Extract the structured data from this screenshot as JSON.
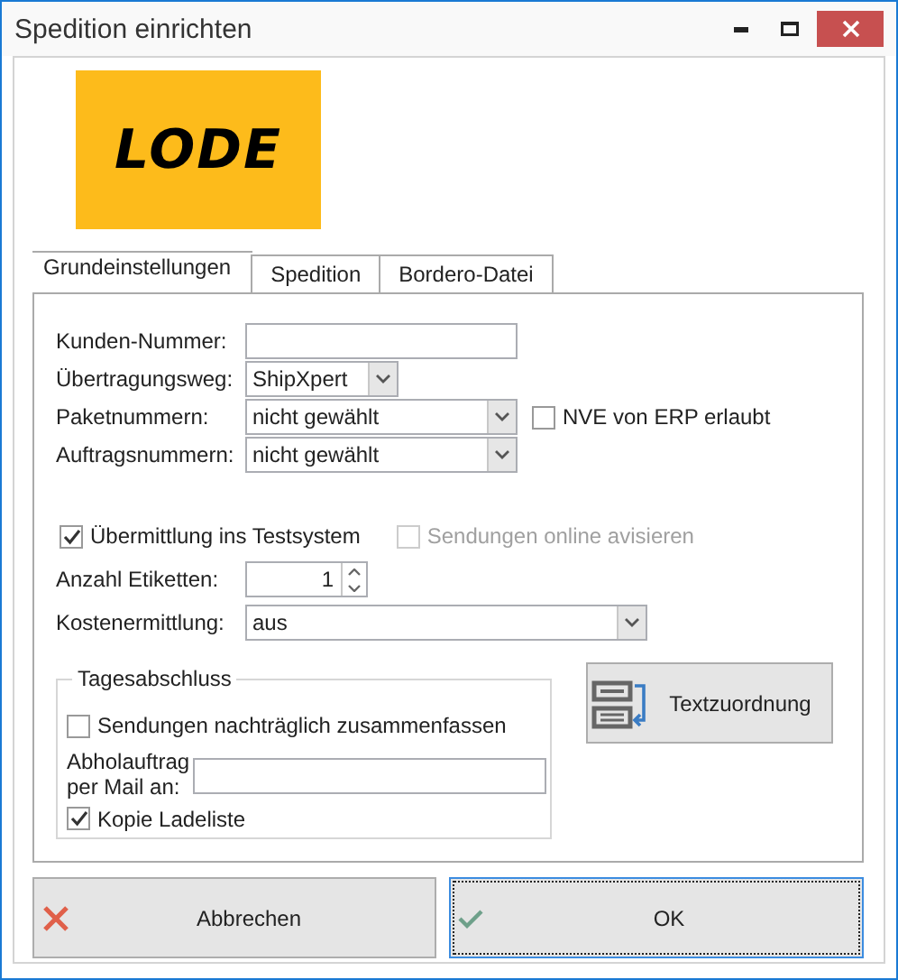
{
  "window": {
    "title": "Spedition einrichten"
  },
  "logo": {
    "text": "LODE"
  },
  "tabs": [
    {
      "label": "Grundeinstellungen",
      "selected": true
    },
    {
      "label": "Spedition",
      "selected": false
    },
    {
      "label": "Bordero-Datei",
      "selected": false
    }
  ],
  "fields": [
    {
      "kind": "text",
      "label": "Kunden-Nummer:"
    },
    {
      "kind": "combo",
      "label": "Übertragungsweg:",
      "value": "ShipXpert"
    },
    {
      "kind": "combo",
      "label": "Paketnummern:",
      "value": "nicht gewählt",
      "checkbox": {
        "label": "NVE von ERP erlaubt",
        "checked": false
      }
    },
    {
      "kind": "combo",
      "label": "Auftragsnummern:",
      "value": "nicht gewählt"
    }
  ],
  "options": [
    {
      "label": "Übermittlung ins Testsystem",
      "checked": true,
      "disabled": false
    },
    {
      "label": "Sendungen online avisieren",
      "checked": false,
      "disabled": true
    }
  ],
  "label_count": {
    "label": "Anzahl Etiketten:",
    "value": "1"
  },
  "cost": {
    "label": "Kostenermittlung:",
    "value": "aus"
  },
  "daily_closing": {
    "title": "Tagesabschluss",
    "merge": {
      "label": "Sendungen nachträglich zusammenfassen",
      "checked": false
    },
    "mail": {
      "label": "Abholauftrag per Mail an:"
    },
    "copy": {
      "label": "Kopie Ladeliste",
      "checked": true
    }
  },
  "text_mapping_button": "Textzuordnung",
  "buttons": [
    {
      "kind": "cancel",
      "label": "Abbrechen",
      "focused": false
    },
    {
      "kind": "ok",
      "label": "OK",
      "focused": true
    }
  ]
}
